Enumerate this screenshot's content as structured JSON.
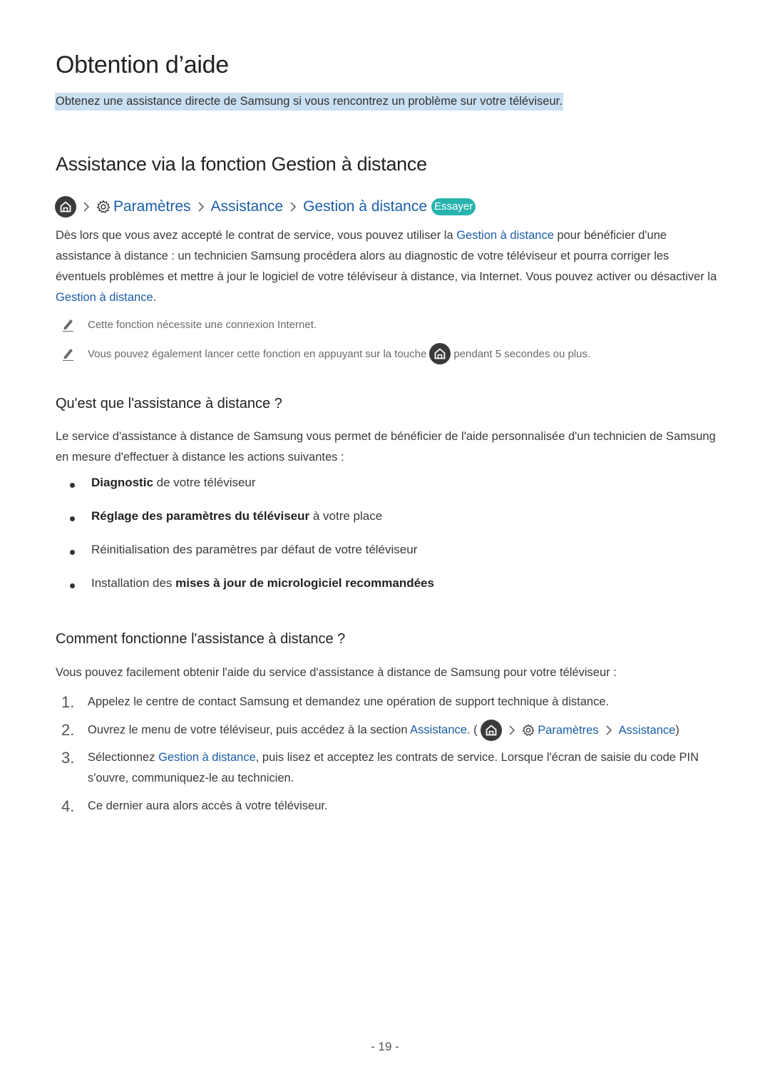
{
  "title": "Obtention d’aide",
  "intro": "Obtenez une assistance directe de Samsung si vous rencontrez un problème sur votre téléviseur.",
  "section": {
    "heading": "Assistance via la fonction Gestion à distance",
    "breadcrumb": {
      "home_icon": "home-icon",
      "settings_icon": "gear-icon",
      "items": [
        "Paramètres",
        "Assistance",
        "Gestion à distance"
      ],
      "try_badge": "Essayer"
    },
    "description": {
      "part1": "Dès lors que vous avez accepté le contrat de service, vous pouvez utiliser la ",
      "link1": "Gestion à distance",
      "part2": " pour bénéficier d'une assistance à distance : un technicien Samsung procédera alors au diagnostic de votre téléviseur et pourra corriger les éventuels problèmes et mettre à jour le logiciel de votre téléviseur à distance, via Internet. Vous pouvez activer ou désactiver la ",
      "link2": "Gestion à distance",
      "part3": "."
    },
    "notes": [
      {
        "text": "Cette fonction nécessite une connexion Internet."
      },
      {
        "text_before": "Vous pouvez également lancer cette fonction en appuyant sur la touche",
        "text_after": "pendant 5 secondes ou plus."
      }
    ]
  },
  "what_is": {
    "heading": "Qu'est que l'assistance à distance ?",
    "paragraph": "Le service d'assistance à distance de Samsung vous permet de bénéficier de l'aide personnalisée d'un technicien de Samsung en mesure d'effectuer à distance les actions suivantes :",
    "bullets": [
      {
        "strong": "Diagnostic",
        "rest": " de votre téléviseur"
      },
      {
        "strong": "Réglage des paramètres du téléviseur",
        "rest": " à votre place"
      },
      {
        "plain": "Réinitialisation des paramètres par défaut de votre téléviseur"
      },
      {
        "pre": "Installation des ",
        "strong": "mises à jour de micrologiciel recommandées"
      }
    ]
  },
  "how": {
    "heading": "Comment fonctionne l'assistance à distance ?",
    "paragraph": "Vous pouvez facilement obtenir l'aide du service d'assistance à distance de Samsung pour votre téléviseur :",
    "steps": [
      {
        "num": "1.",
        "text": "Appelez le centre de contact Samsung et demandez une opération de support technique à distance."
      },
      {
        "num": "2.",
        "pre": "Ouvrez le menu de votre téléviseur, puis accédez à la section ",
        "link": "Assistance",
        "mid": ". (",
        "crumb": [
          "Paramètres",
          "Assistance"
        ],
        "post": ")"
      },
      {
        "num": "3.",
        "pre": "Sélectionnez ",
        "link": "Gestion à distance",
        "post": ", puis lisez et acceptez les contrats de service. Lorsque l'écran de saisie du code PIN s'ouvre, communiquez-le au technicien."
      },
      {
        "num": "4.",
        "text": "Ce dernier aura alors accès à votre téléviseur."
      }
    ]
  },
  "page_number": "- 19 -"
}
